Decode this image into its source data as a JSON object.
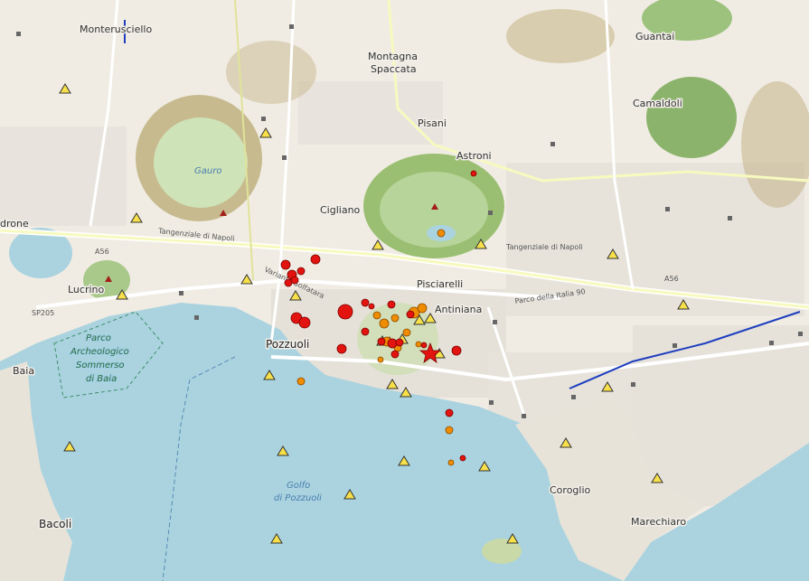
{
  "places": {
    "monterusciello": "Monterusciello",
    "montagna_spaccata_1": "Montagna",
    "montagna_spaccata_2": "Spaccata",
    "guantai": "Guantai",
    "pisani": "Pisani",
    "camaldoli": "Camaldoli",
    "astroni": "Astroni",
    "gauro": "Gauro",
    "cigliano": "Cigliano",
    "arcofelice": "drone",
    "lucrino": "Lucrino",
    "pisciarelli": "Pisciarelli",
    "antiniana": "Antiniana",
    "pozzuoli": "Pozzuoli",
    "baia": "Baia",
    "bacoli": "Bacoli",
    "coroglio": "Coroglio",
    "marechiaro": "Marechiaro"
  },
  "water": {
    "golfo_1": "Golfo",
    "golfo_2": "di Pozzuoli"
  },
  "park": {
    "line1": "Parco",
    "line2": "Archeologico",
    "line3": "Sommerso",
    "line4": "di Baia"
  },
  "roads": {
    "tangenziale_w": "Tangenziale di Napoli",
    "tangenziale_e": "Tangenziale di Napoli",
    "a56_w": "A56",
    "a56_e": "A56",
    "sp205": "SP205",
    "via_italia": "Parco della Italia 90",
    "domiziana": "Variante Solfatara"
  },
  "colors": {
    "sea": "#aad3df",
    "land": "#f2efe9",
    "forest": "#add19e",
    "crater": "#8fb36a",
    "quake_red": "#e3140f",
    "quake_orange": "#f08c00",
    "station_yellow": "#f7e04a",
    "rail": "#1f3fbf"
  },
  "legend_symbols": {
    "earthquake_recent": "red circle",
    "earthquake_older": "orange circle",
    "station": "yellow triangle",
    "epicenter_main": "red star",
    "volcano": "dark red triangle"
  }
}
